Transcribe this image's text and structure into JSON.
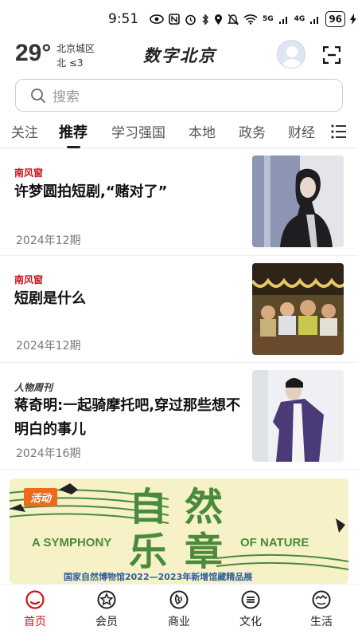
{
  "status_bar": {
    "time": "9:51",
    "network_5g": "5G",
    "network_4g": "4G",
    "battery": "96"
  },
  "header": {
    "temperature": "29°",
    "location": "北京城区",
    "wind": "北  ≤3",
    "brand": "数字北京"
  },
  "search": {
    "placeholder": "搜索"
  },
  "tabs": [
    {
      "label": "关注"
    },
    {
      "label": "推荐"
    },
    {
      "label": "学习强国"
    },
    {
      "label": "本地"
    },
    {
      "label": "政务"
    },
    {
      "label": "财经"
    }
  ],
  "articles": [
    {
      "source": "南风窗",
      "title": "许梦圆拍短剧,“赌对了”",
      "date": "2024年12期"
    },
    {
      "source": "南风窗",
      "title": "短剧是什么",
      "date": "2024年12期"
    },
    {
      "source": "人物周刊",
      "title": "蒋奇明:一起骑摩托吧,穿过那些想不明白的事儿",
      "date": "2024年16期"
    }
  ],
  "banner": {
    "tag": "活动",
    "big_1": "自",
    "big_2": "然",
    "big_3": "乐",
    "big_4": "章",
    "en_left": "A SYMPHONY",
    "en_right": "OF NATURE",
    "subtitle": "国家自然博物馆2022—2023年新增馆藏精品展"
  },
  "bottom_nav": [
    {
      "label": "首页",
      "icon": "home-icon",
      "active": true
    },
    {
      "label": "会员",
      "icon": "member-icon",
      "active": false
    },
    {
      "label": "商业",
      "icon": "business-icon",
      "active": false
    },
    {
      "label": "文化",
      "icon": "culture-icon",
      "active": false
    },
    {
      "label": "生活",
      "icon": "life-icon",
      "active": false
    }
  ],
  "colors": {
    "accent": "#c8161d",
    "banner_green": "#4a8a3b",
    "banner_bg": "#f6f1c7"
  }
}
